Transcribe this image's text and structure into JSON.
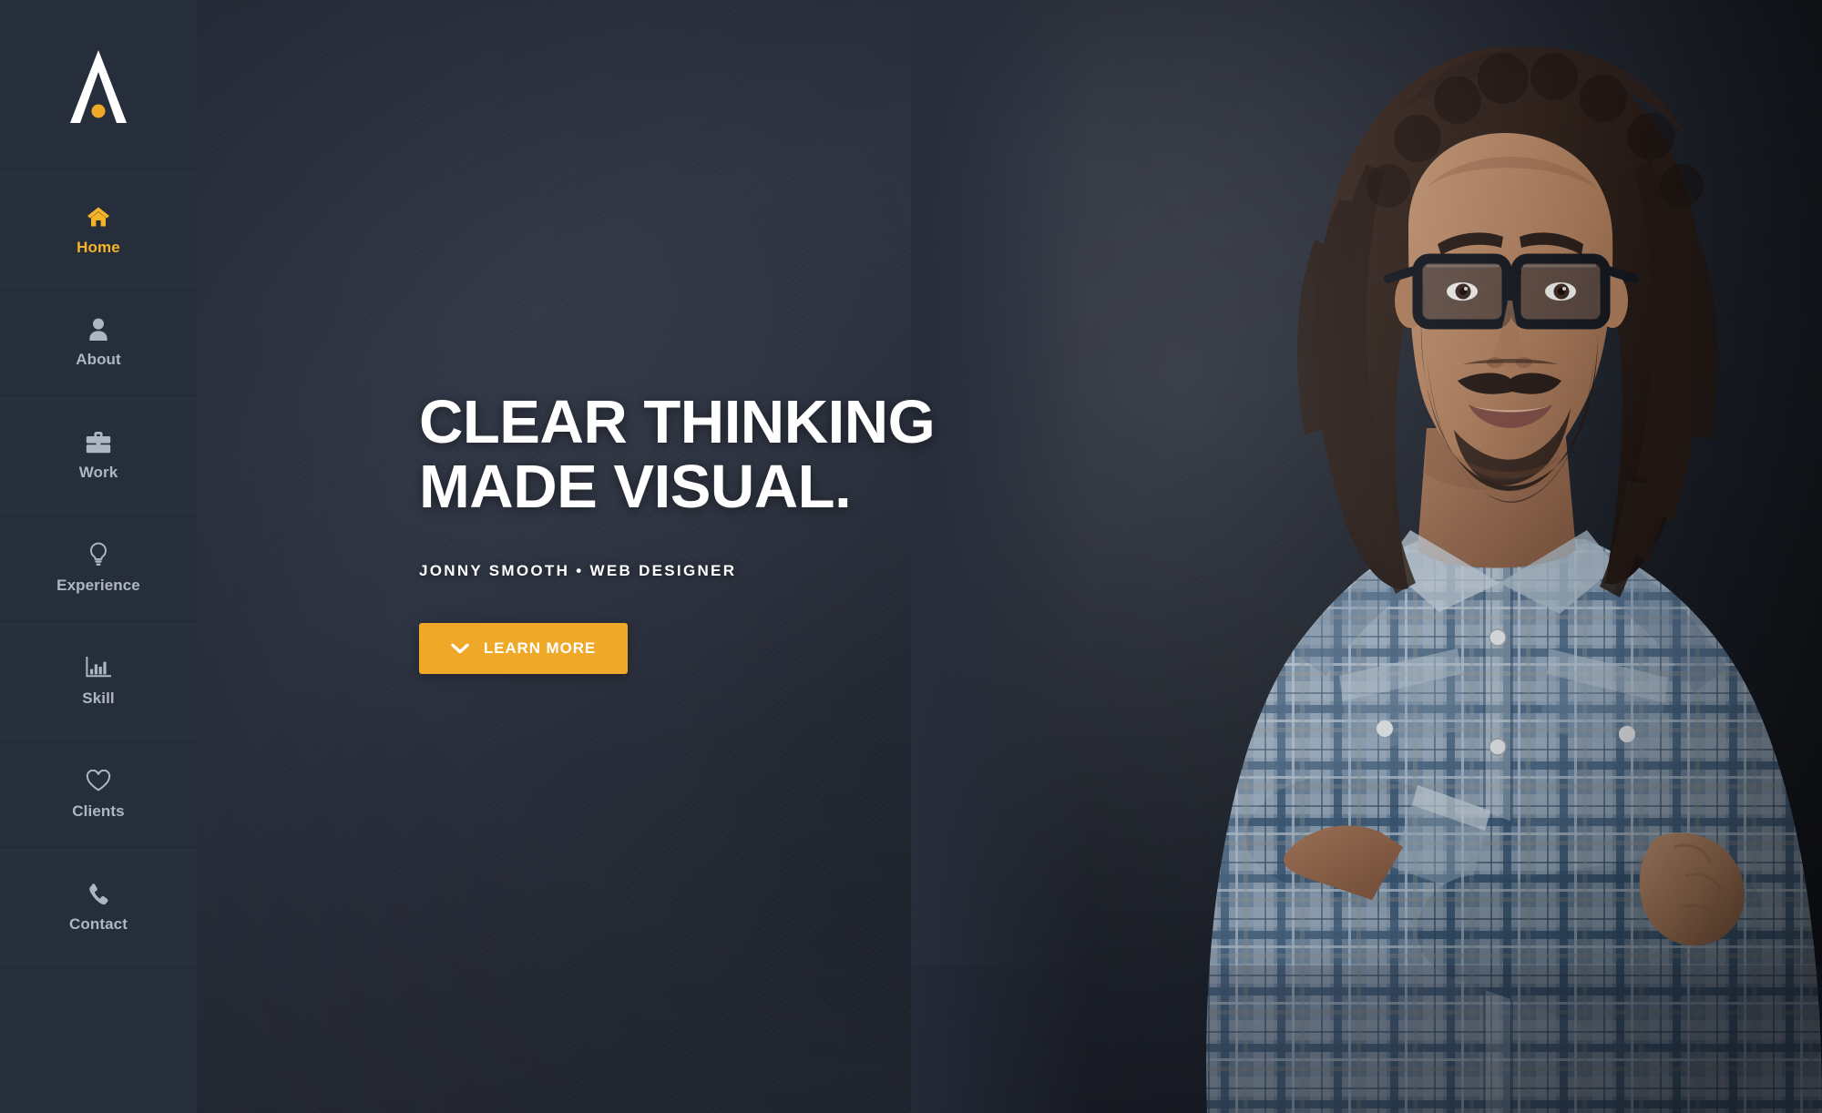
{
  "brand": {
    "logo_letter": "A",
    "logo_name": "logo-a-with-dot",
    "accent_color": "#f0a828",
    "sidebar_bg": "#262e3b",
    "nav_inactive_color": "#aeb6c2"
  },
  "sidebar": {
    "items": [
      {
        "label": "Home",
        "icon": "home-icon",
        "active": true
      },
      {
        "label": "About",
        "icon": "user-icon",
        "active": false
      },
      {
        "label": "Work",
        "icon": "briefcase-icon",
        "active": false
      },
      {
        "label": "Experience",
        "icon": "lightbulb-icon",
        "active": false
      },
      {
        "label": "Skill",
        "icon": "bar-chart-icon",
        "active": false
      },
      {
        "label": "Clients",
        "icon": "heart-icon",
        "active": false
      },
      {
        "label": "Contact",
        "icon": "phone-icon",
        "active": false
      }
    ]
  },
  "hero": {
    "title_line1": "CLEAR THINKING",
    "title_line2": "MADE VISUAL.",
    "subtitle": "JONNY SMOOTH • WEB DESIGNER",
    "cta_label": "LEARN MORE",
    "cta_icon": "chevron-down-icon",
    "photo_alt": "portrait-of-man-with-dreadlocks-glasses-plaid-shirt-arms-crossed"
  }
}
